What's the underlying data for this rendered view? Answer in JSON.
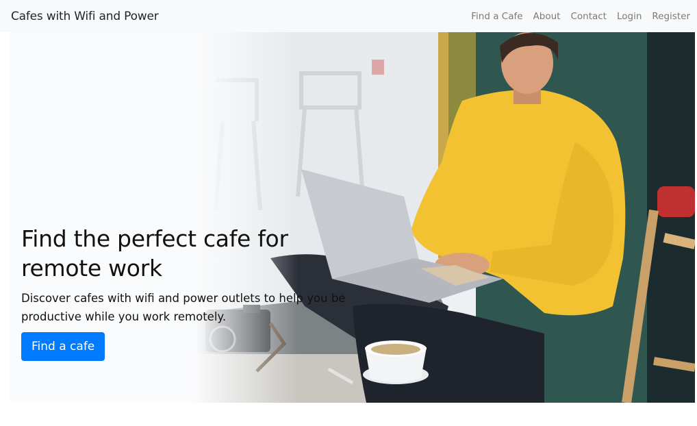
{
  "navbar": {
    "brand": "Cafes with Wifi and Power",
    "links": [
      "Find a Cafe",
      "About",
      "Contact",
      "Login",
      "Register"
    ]
  },
  "hero": {
    "title_line1": "Find the perfect cafe for",
    "title_line2": "remote work",
    "subtitle_line1": "Discover cafes with wifi and power outlets to help you be",
    "subtitle_line2": "productive while you work remotely.",
    "cta_label": "Find a cafe",
    "image_subject": "man-in-yellow-sweater-using-laptop-in-cafe"
  },
  "colors": {
    "navbar_bg": "#f8f9fa",
    "accent": "#007bff",
    "sweater": "#f2c233",
    "wall": "#2f5750"
  }
}
